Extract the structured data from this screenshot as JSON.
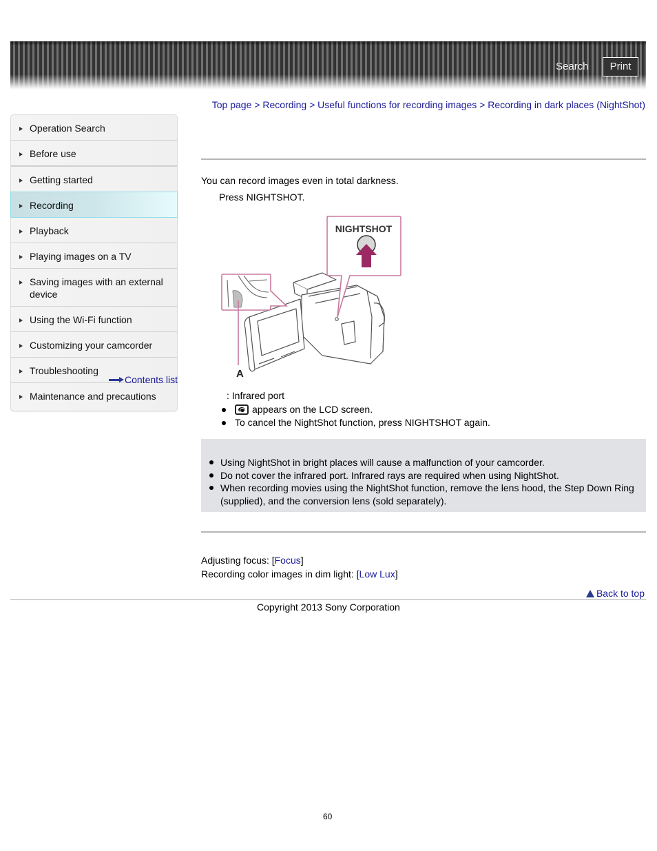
{
  "header": {
    "search_label": "Search",
    "print_label": "Print"
  },
  "breadcrumb": {
    "items": [
      "Top page",
      "Recording",
      "Useful functions for recording images",
      "Recording in dark places (NightShot)"
    ],
    "separator": ">"
  },
  "sidebar": {
    "items": [
      {
        "label": "Operation Search",
        "active": false
      },
      {
        "label": "Before use",
        "active": false
      },
      {
        "label": "Getting started",
        "active": false
      },
      {
        "label": "Recording",
        "active": true
      },
      {
        "label": "Playback",
        "active": false
      },
      {
        "label": "Playing images on a TV",
        "active": false
      },
      {
        "label": "Saving images with an external device",
        "active": false
      },
      {
        "label": "Using the Wi-Fi function",
        "active": false
      },
      {
        "label": "Customizing your camcorder",
        "active": false
      },
      {
        "label": "Troubleshooting",
        "active": false
      },
      {
        "label": "Maintenance and precautions",
        "active": false
      }
    ],
    "contents_link": "Contents list"
  },
  "main": {
    "intro": "You can record images even in total darkness.",
    "step": "Press NIGHTSHOT.",
    "figure": {
      "button_label": "NIGHTSHOT",
      "callout_label": "A",
      "accent_color": "#c8799f",
      "arrow_color": "#9b2a64"
    },
    "caption": ": Infrared port",
    "bullets": [
      {
        "icon": "nightshot-icon",
        "text": "appears on the LCD screen."
      },
      {
        "icon": null,
        "text": "To cancel the NightShot function, press NIGHTSHOT again."
      }
    ],
    "notes": [
      "Using NightShot in bright places will cause a malfunction of your camcorder.",
      "Do not cover the infrared port. Infrared rays are required when using NightShot.",
      "When recording movies using the NightShot function, remove the lens hood, the Step Down Ring (supplied), and the conversion lens (sold separately)."
    ],
    "related": [
      {
        "prefix": "Adjusting focus: [",
        "link": "Focus",
        "suffix": "]"
      },
      {
        "prefix": "Recording color images in dim light: [",
        "link": "Low Lux",
        "suffix": "]"
      }
    ]
  },
  "footer": {
    "back_to_top": "Back to top",
    "copyright": "Copyright 2013 Sony Corporation",
    "page_number": "60"
  },
  "colors": {
    "link": "#1a1a9c",
    "note_background": "#e0e2e6",
    "active_nav_border": "#8fdcea"
  }
}
